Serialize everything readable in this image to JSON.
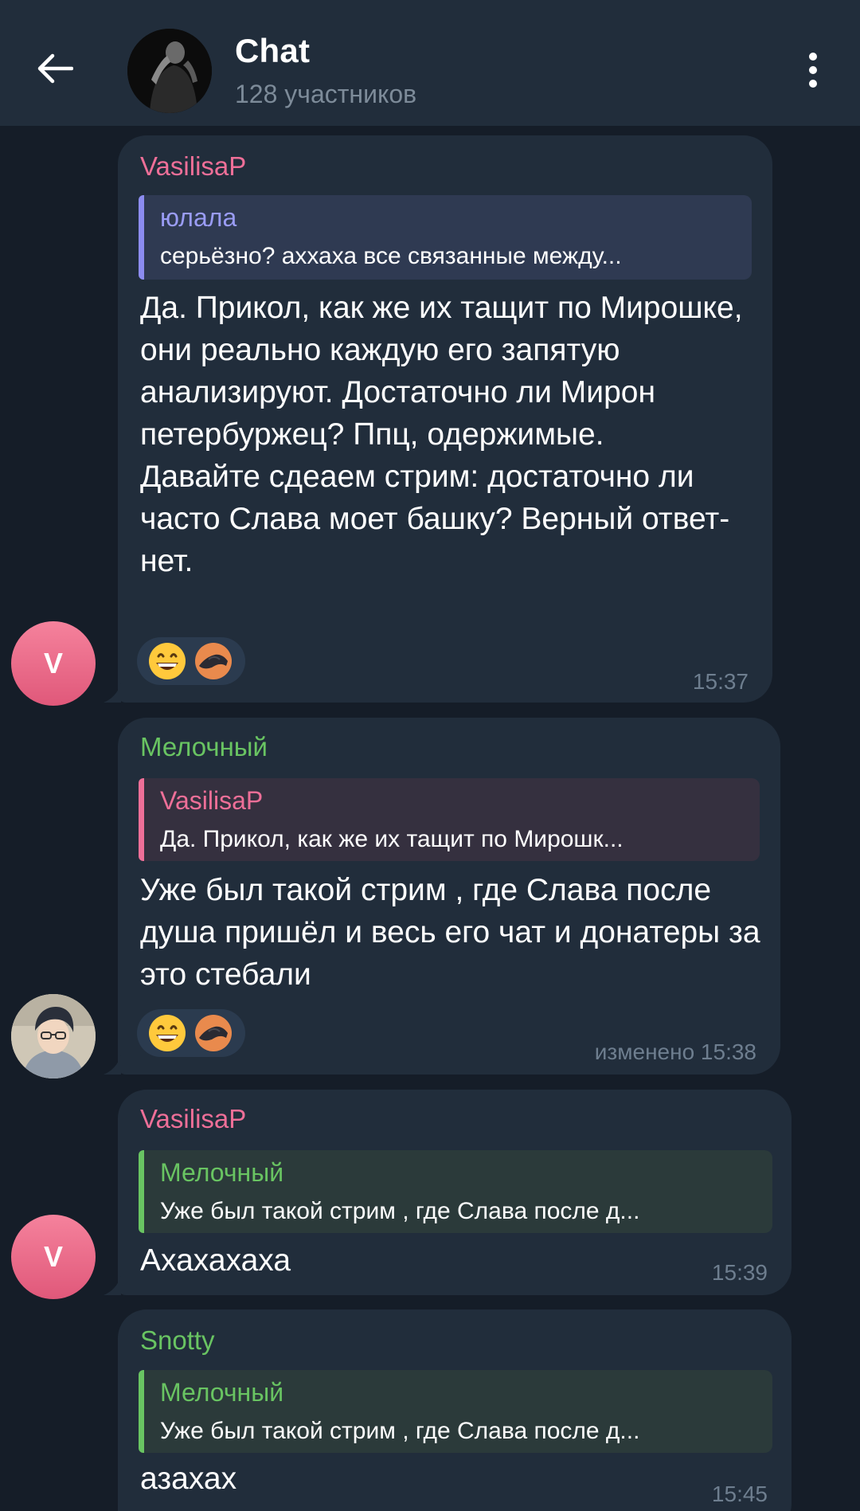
{
  "header": {
    "title": "Chat",
    "subtitle": "128 участников"
  },
  "messages": [
    {
      "sender": "VasilisaP",
      "avatar_letter": "V",
      "reply": {
        "name": "юлала",
        "text": "серьёзно? аххаха все связанные между..."
      },
      "text": "Да. Прикол, как же их тащит по Мирошке, они реально каждую его запятую анализируют. Достаточно ли Мирон петербуржец? Ппц, одержимые.\nДавайте сдеаем стрим: достаточно ли часто Слава моет башку? Верный ответ-нет.",
      "reactions": [
        "grinning-face-emoji",
        "custom-emoji"
      ],
      "time": "15:37"
    },
    {
      "sender": "Мелочный",
      "reply": {
        "name": "VasilisaP",
        "text": "Да. Прикол, как же их тащит по Мирошк..."
      },
      "text": "Уже был такой стрим , где Слава после душа пришёл и весь его чат и донатеры за это стебали",
      "reactions": [
        "grinning-face-emoji",
        "custom-emoji"
      ],
      "time": "изменено 15:38"
    },
    {
      "sender": "VasilisaP",
      "avatar_letter": "V",
      "reply": {
        "name": "Мелочный",
        "text": "Уже был такой стрим , где Слава после д..."
      },
      "text": "Ахахахаха",
      "time": "15:39"
    },
    {
      "sender": "Snotty",
      "reply": {
        "name": "Мелочный",
        "text": "Уже был такой стрим , где Слава после д..."
      },
      "text": "азахах",
      "time": "15:45"
    }
  ],
  "colors": {
    "background": "#151d28",
    "header_bg": "#212d3b",
    "bubble_bg": "#212d3b",
    "pink_name": "#ee6f98",
    "green_name": "#69c462",
    "violet_name": "#9a9cf5"
  }
}
